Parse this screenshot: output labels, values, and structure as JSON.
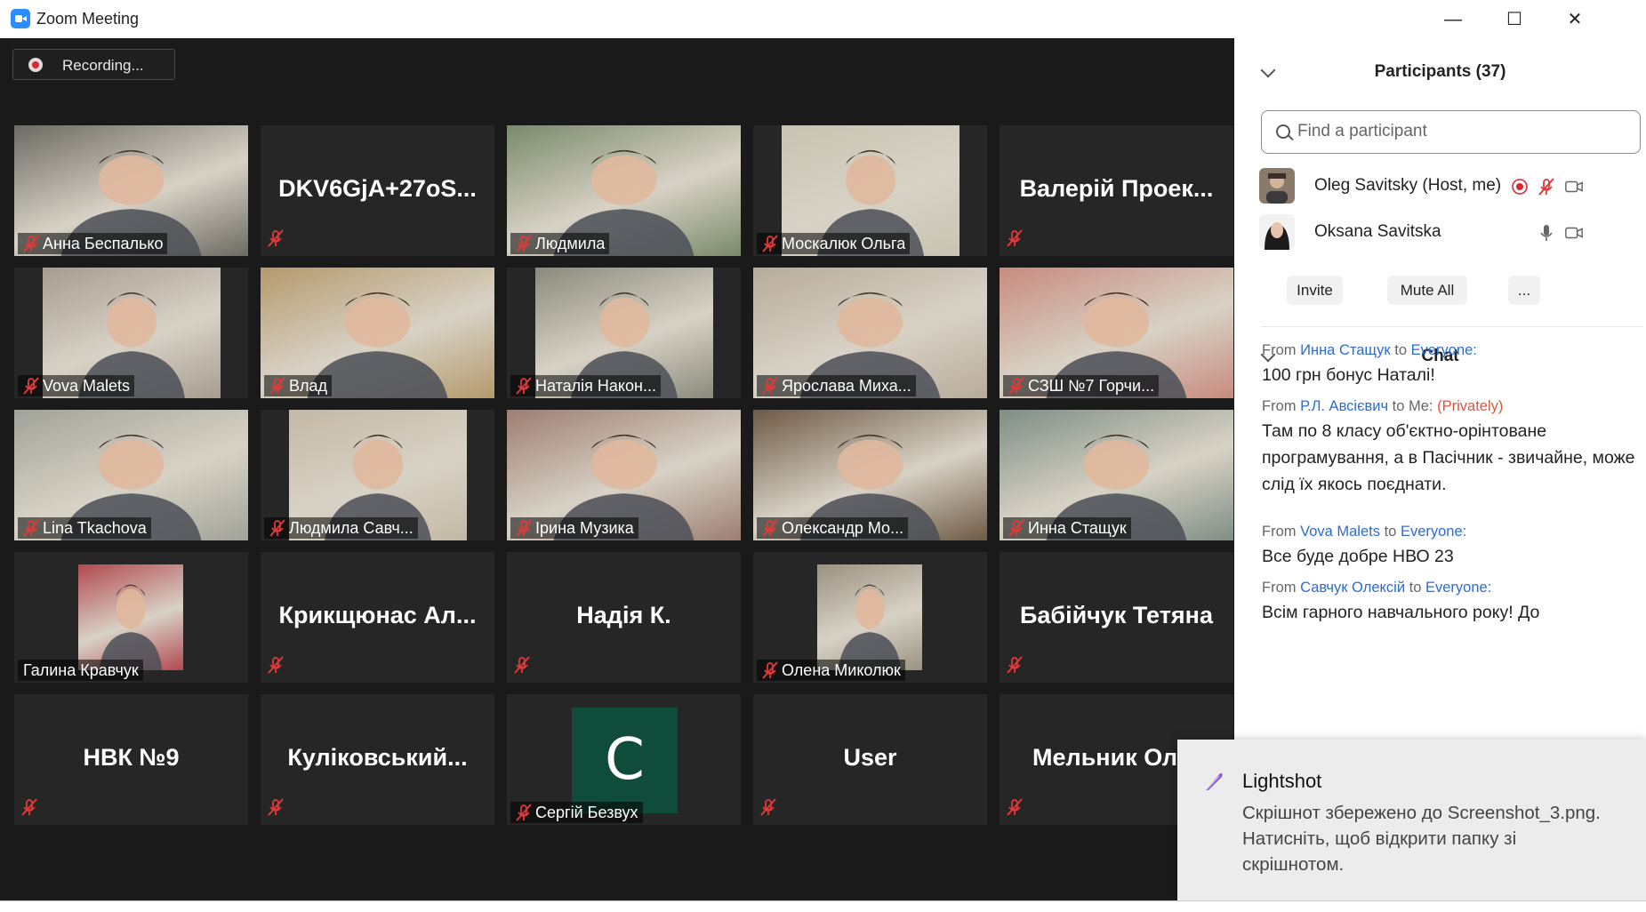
{
  "window": {
    "title": "Zoom Meeting",
    "minimize": "—",
    "maximize": "☐",
    "close": "✕"
  },
  "recording": {
    "label": "Recording..."
  },
  "tiles": [
    {
      "name": "Анна Беспалько",
      "kind": "video",
      "bg": "#6c6a62"
    },
    {
      "name": "DKV6GjA+27oS...",
      "kind": "text"
    },
    {
      "name": "Людмила",
      "kind": "video",
      "bg": "#7a8a6a"
    },
    {
      "name": "Москалюк Ольга",
      "kind": "video-narrow",
      "bg": "#c9c3b3"
    },
    {
      "name": "Валерій  Проек...",
      "kind": "text"
    },
    {
      "name": "Vova Malets",
      "kind": "video-narrow",
      "bg": "#a89c90"
    },
    {
      "name": "Влад",
      "kind": "video",
      "bg": "#b49a6c"
    },
    {
      "name": "Наталія Након...",
      "kind": "video-narrow",
      "bg": "#8a8b7c"
    },
    {
      "name": "Ярослава Миха...",
      "kind": "video",
      "bg": "#b8ab9a"
    },
    {
      "name": "СЗШ №7 Горчи...",
      "kind": "video",
      "bg": "#c88b7e"
    },
    {
      "name": "Lina Tkachova",
      "kind": "video",
      "bg": "#a1a398"
    },
    {
      "name": "Людмила Савч...",
      "kind": "video-narrow",
      "bg": "#c4b8a4"
    },
    {
      "name": "Ірина Музика",
      "kind": "video",
      "bg": "#9d7e72"
    },
    {
      "name": "Олександр Мо...",
      "kind": "video",
      "bg": "#6e5a45"
    },
    {
      "name": "Инна Стащук",
      "kind": "video",
      "bg": "#7f8e84"
    },
    {
      "name": "Галина Кравчук",
      "kind": "photo",
      "bg": "#b2494f"
    },
    {
      "name": "Крикщюнас  Ал...",
      "kind": "text"
    },
    {
      "name": "Надія К.",
      "kind": "text"
    },
    {
      "name": "Олена Миколюк",
      "kind": "photo",
      "bg": "#9a9280"
    },
    {
      "name": "Бабійчук Тетяна",
      "kind": "text"
    },
    {
      "name": "НВК №9",
      "kind": "text"
    },
    {
      "name": "Куліковський...",
      "kind": "text"
    },
    {
      "name": "Сергій Безвух",
      "kind": "avatar",
      "letter": "C"
    },
    {
      "name": "User",
      "kind": "text"
    },
    {
      "name": "Мельник Олег",
      "kind": "text"
    }
  ],
  "participants": {
    "title": "Participants (37)",
    "search_placeholder": "Find a participant",
    "list": [
      {
        "name": "Oleg Savitsky (Host, me)"
      },
      {
        "name": "Oksana Savitska"
      }
    ],
    "invite_label": "Invite",
    "mute_all_label": "Mute All",
    "more_label": "..."
  },
  "chat": {
    "title": "Chat",
    "messages": [
      {
        "from_word": "From",
        "sender": "Инна Стащук",
        "to_word": "to",
        "recipient": "Everyone:",
        "private": "",
        "text": "100 грн бонус Наталі!"
      },
      {
        "from_word": "From",
        "sender": "Р.Л. Авсієвич",
        "to_word": "to Me:",
        "recipient": "",
        "private": "(Privately)",
        "text": "Там  по 8 класу об'єктно-орінтоване програмування, а в Пасічник - звичайне, може слід їх якось поєднати."
      },
      {
        "from_word": "From",
        "sender": "Vova Malets",
        "to_word": "to",
        "recipient": "Everyone:",
        "private": "",
        "text": "Все буде добре НВО 23"
      },
      {
        "from_word": "From",
        "sender": "Савчук Олексій",
        "to_word": "to",
        "recipient": "Everyone:",
        "private": "",
        "text": "Всім гарного навчального року! До"
      }
    ]
  },
  "toast": {
    "app": "Lightshot",
    "body": "Скрішнот збережено до Screenshot_3.png. Натисніть, щоб відкрити папку зі скрішнотом."
  },
  "colors": {
    "accent": "#2d8cff",
    "muted_red": "#e03a3a",
    "record_red": "#d9282f",
    "link_blue": "#2d6cd1",
    "private_red": "#e0533a"
  }
}
